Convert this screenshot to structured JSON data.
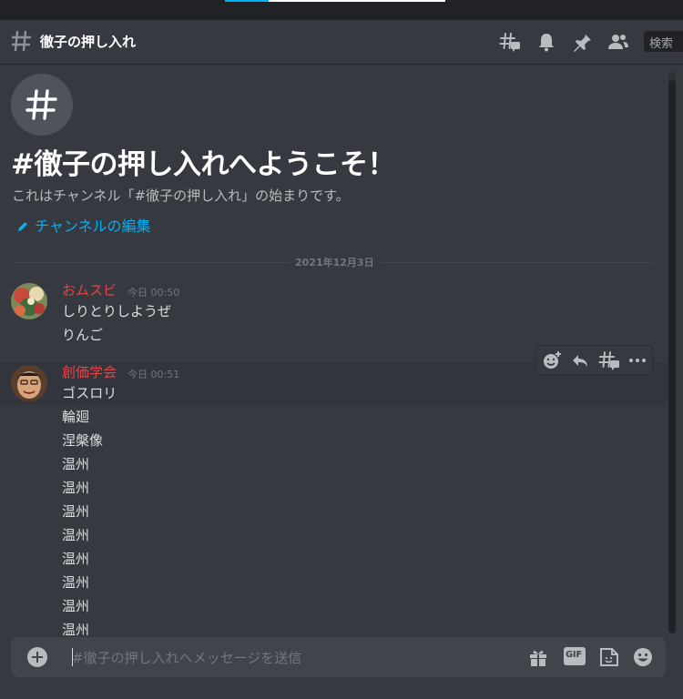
{
  "header": {
    "channel_name": "徹子の押し入れ",
    "search_placeholder": "検索",
    "icons": [
      "threads-icon",
      "bell-icon",
      "pin-icon",
      "members-icon"
    ]
  },
  "welcome": {
    "title": "#徹子の押し入れへようこそ！",
    "subtitle": "これはチャンネル「#徹子の押し入れ」の始まりです。",
    "edit_link": "チャンネルの編集"
  },
  "divider": {
    "date": "2021年12月3日"
  },
  "messages": [
    {
      "author": "おムスビ",
      "timestamp": "今日 00:50",
      "author_color": "#ed4245",
      "lines": [
        "しりとりしようぜ",
        "りんご"
      ]
    },
    {
      "author": "創価学会",
      "timestamp": "今日 00:51",
      "author_color": "#ed4245",
      "lines": [
        "ゴスロリ",
        "輪廻",
        "涅槃像",
        "温州",
        "温州",
        "温州",
        "温州",
        "温州",
        "温州",
        "温州",
        "温州"
      ]
    }
  ],
  "message_toolbar": {
    "icons": [
      "add-reaction-icon",
      "reply-icon",
      "create-thread-icon",
      "more-icon"
    ]
  },
  "composer": {
    "placeholder": "#徹子の押し入れへメッセージを送信",
    "gif_label": "GIF",
    "icons": [
      "gift-icon",
      "gif-icon",
      "sticker-icon",
      "emoji-icon"
    ]
  },
  "colors": {
    "background": "#36393f",
    "accent_link": "#00b0f4",
    "author_red": "#ed4245",
    "composer_bg": "#40444b"
  }
}
